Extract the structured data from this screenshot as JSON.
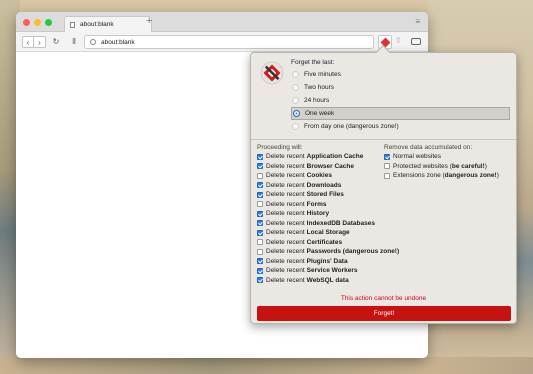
{
  "browser": {
    "tab_title": "about:blank",
    "url": "about:blank",
    "new_tab_glyph": "+",
    "menu_glyph": "≡",
    "back_glyph": "‹",
    "forward_glyph": "›",
    "reload_glyph": "↻",
    "library_glyph": "⫴",
    "share_glyph": "⇧"
  },
  "popup": {
    "title": "Forget the last:",
    "periods": [
      {
        "label": "Five minutes",
        "selected": false
      },
      {
        "label": "Two hours",
        "selected": false
      },
      {
        "label": "24 hours",
        "selected": false
      },
      {
        "label": "One week",
        "selected": true
      },
      {
        "label": "From day one (dangerous zone!)",
        "selected": false
      }
    ],
    "proceeding_title": "Proceeding will:",
    "remove_title": "Remove data accumulated on:",
    "actions": [
      {
        "prefix": "Delete recent",
        "item": "Application Cache",
        "checked": true
      },
      {
        "prefix": "Delete recent",
        "item": "Browser Cache",
        "checked": true
      },
      {
        "prefix": "Delete recent",
        "item": "Cookies",
        "checked": false
      },
      {
        "prefix": "Delete recent",
        "item": "Downloads",
        "checked": true
      },
      {
        "prefix": "Delete recent",
        "item": "Stored Files",
        "checked": true
      },
      {
        "prefix": "Delete recent",
        "item": "Forms",
        "checked": false
      },
      {
        "prefix": "Delete recent",
        "item": "History",
        "checked": true
      },
      {
        "prefix": "Delete recent",
        "item": "IndexedDB Databases",
        "checked": true
      },
      {
        "prefix": "Delete recent",
        "item": "Local Storage",
        "checked": true
      },
      {
        "prefix": "Delete recent",
        "item": "Certificates",
        "checked": false
      },
      {
        "prefix": "Delete recent",
        "item": "Passwords (dangerous zone!)",
        "checked": false
      },
      {
        "prefix": "Delete recent",
        "item": "Plugins' Data",
        "checked": true
      },
      {
        "prefix": "Delete recent",
        "item": "Service Workers",
        "checked": true
      },
      {
        "prefix": "Delete recent",
        "item": "WebSQL data",
        "checked": true
      }
    ],
    "remove_options": [
      {
        "text": "Normal websites",
        "bold": "",
        "suffix": "",
        "checked": true
      },
      {
        "text": "Protected websites (",
        "bold": "be careful!",
        "suffix": ")",
        "checked": false
      },
      {
        "text": "Extensions zone (",
        "bold": "dangerous zone!",
        "suffix": ")",
        "checked": false
      }
    ],
    "warning": "This action cannot be undone",
    "forget_button": "Forget!"
  },
  "colors": {
    "accent": "#2b7fe6",
    "danger": "#c7120f",
    "warning_text": "#d0021b"
  }
}
